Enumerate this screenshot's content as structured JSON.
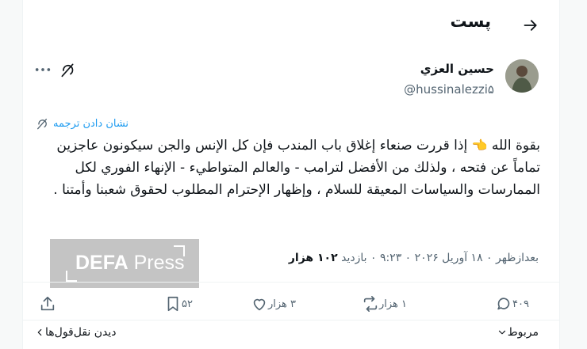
{
  "header": {
    "title": "پست"
  },
  "author": {
    "name": "حسين العزي",
    "handle": "@hussinalezzi۵"
  },
  "translate": {
    "label": "نشان دادن ترجمه"
  },
  "tweet": {
    "text_line_prefix": "بقوة الله",
    "emoji": "👈",
    "text": "إذا قررت صنعاء إغلاق باب المندب فإن كل الإنس والجن سيكونون عاجزين تماماً عن فتحه ، ولذلك من الأفضل لترامب - والعالم المتواطيء - الإنهاء الفوري لكل الممارسات والسياسات المعيقة للسلام ، وإظهار الإحترام المطلوب لحقوق شعبنا وأمتنا ."
  },
  "media": {
    "watermark_bold": "DEFA",
    "watermark_regular": " Press"
  },
  "meta": {
    "date_text": "بعدازظهر ۰ ۱۸ آوریل ۲۰۲۶ ۰ ۹:۲۳ ۰ بازدید",
    "views": "۱۰۲ هزار"
  },
  "actions": {
    "replies": "۴۰۹",
    "reposts": "۱ هزار",
    "likes": "۳ هزار",
    "bookmarks": "۵۲"
  },
  "bottom": {
    "related": "مربوط",
    "quotes": "دیدن نقل‌قول‌ها"
  },
  "colors": {
    "accent": "#1d9bf0",
    "secondary_text": "#536471",
    "text": "#0f1419"
  },
  "icons": [
    "back-arrow-icon",
    "more-icon",
    "grok-icon",
    "translate-icon",
    "reply-icon",
    "repost-icon",
    "like-icon",
    "bookmark-icon",
    "share-icon",
    "chevron-down-icon",
    "chevron-left-icon"
  ]
}
